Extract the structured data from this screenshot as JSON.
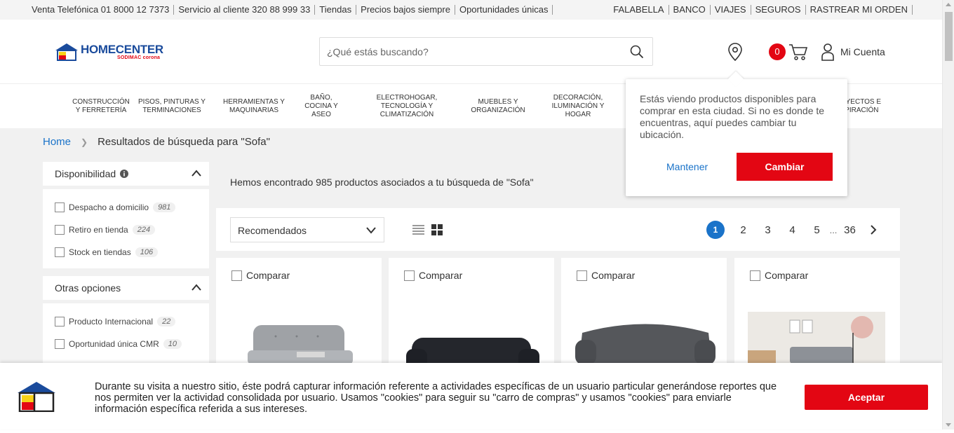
{
  "topbar": {
    "left": [
      "Venta Telefónica 01 8000 12 7373",
      "Servicio al cliente 320 88 999 33",
      "Tiendas",
      "Precios bajos siempre",
      "Oportunidades únicas"
    ],
    "right": [
      "Falabella",
      "Banco",
      "Viajes",
      "Seguros",
      "Rastrear mi orden"
    ]
  },
  "header": {
    "logo_text": "HOMECENTER",
    "logo_sub": "SODIMAC corona",
    "search_placeholder": "¿Qué estás buscando?",
    "cart_count": "0",
    "account_label": "Mi Cuenta"
  },
  "nav": [
    "Construcción\ny ferretería",
    "Pisos, pinturas y\nterminaciones",
    "Herramientas y\nmaquinarias",
    "Baño,\ncocina y\naseo",
    "Electrohogar,\ntecnología y\nclimatización",
    "Muebles y\norganización",
    "Decoración,\niluminación y\nhogar",
    "Proyectos e\ninspiración"
  ],
  "breadcrumb": {
    "home": "Home",
    "current": "Resultados de búsqueda para \"Sofa\""
  },
  "filters": {
    "availability_title": "Disponibilidad",
    "availability": [
      {
        "label": "Despacho a domicilio",
        "count": "981"
      },
      {
        "label": "Retiro en tienda",
        "count": "224"
      },
      {
        "label": "Stock en tiendas",
        "count": "106"
      }
    ],
    "other_title": "Otras opciones",
    "other": [
      {
        "label": "Producto Internacional",
        "count": "22"
      },
      {
        "label": "Oportunidad única CMR",
        "count": "10"
      }
    ]
  },
  "results_text": "Hemos encontrado 985 productos asociados a tu búsqueda de \"Sofa\"",
  "toolbar": {
    "sort_value": "Recomendados",
    "pages": [
      "1",
      "2",
      "3",
      "4",
      "5"
    ],
    "dots": "...",
    "last_page": "36"
  },
  "cards": [
    {
      "compare": "Comparar"
    },
    {
      "compare": "Comparar"
    },
    {
      "compare": "Comparar"
    },
    {
      "compare": "Comparar"
    }
  ],
  "popup": {
    "message": "Estás viendo productos disponibles para comprar en esta ciudad. Si no es donde te encuentras, aquí puedes cambiar tu ubicación.",
    "keep": "Mantener",
    "change": "Cambiar"
  },
  "cookie": {
    "text": "Durante su visita a nuestro sitio, éste podrá capturar información referente a actividades específicas de un usuario particular generándose reportes que nos permiten ver la actividad consolidada por usuario. Usamos \"cookies\" para seguir su \"carro de compras\" y usamos \"cookies\" para enviarle información específica referida a sus intereses.",
    "accept": "Aceptar"
  },
  "colors": {
    "brand_red": "#e30613",
    "brand_blue": "#1a4b9c",
    "link_blue": "#1a73c9"
  }
}
